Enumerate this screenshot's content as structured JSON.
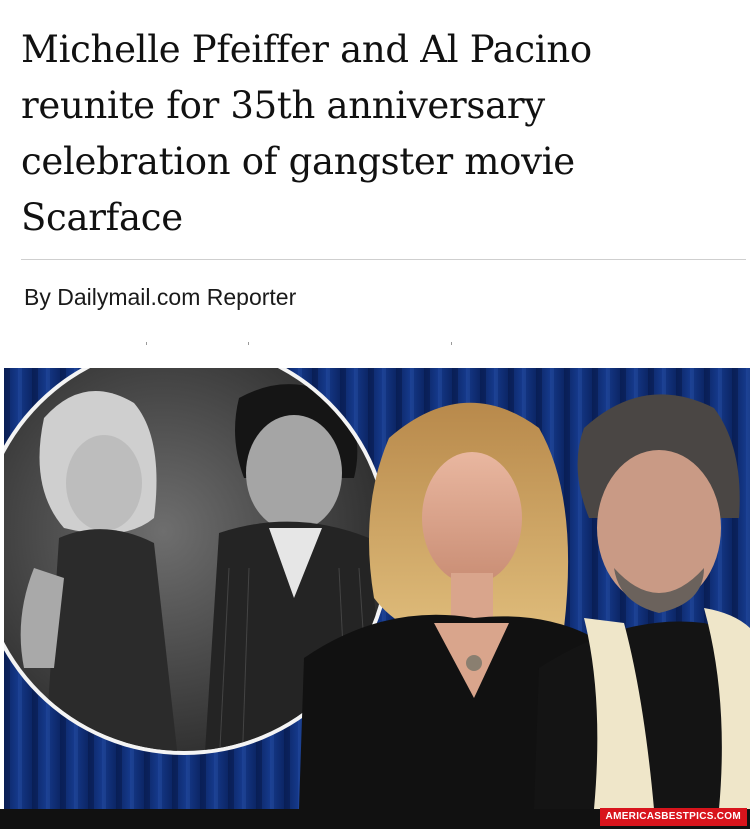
{
  "article": {
    "headline": "Michelle Pfeiffer and Al Pacino reunite for 35th anniversary celebration of gangster movie Scarface",
    "byline": "By Dailymail.com Reporter"
  },
  "photo": {
    "inset": "black-and-white film still in circular frame",
    "main": "two people in front of a blue curtain"
  },
  "watermark": {
    "text": "AMERICASBESTPICS.COM"
  },
  "colors": {
    "curtain_blue": "#13357f",
    "watermark_red": "#d8141c",
    "divider": "#cfcfcf"
  }
}
